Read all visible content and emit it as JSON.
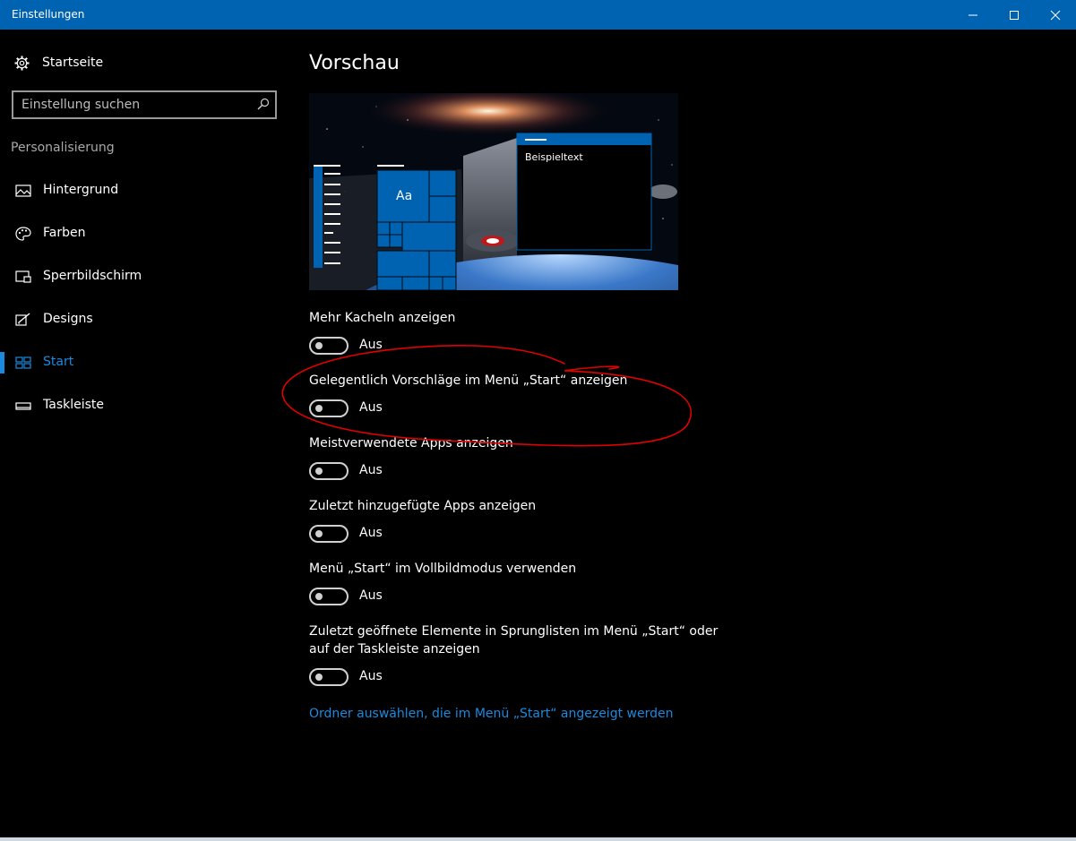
{
  "window": {
    "title": "Einstellungen",
    "controls": {
      "minimize": "—",
      "maximize": "☐",
      "close": "✕"
    },
    "accent": "#0063b1"
  },
  "sidebar": {
    "home_label": "Startseite",
    "search_placeholder": "Einstellung suchen",
    "section_label": "Personalisierung",
    "items": [
      {
        "label": "Hintergrund",
        "icon": "image-icon"
      },
      {
        "label": "Farben",
        "icon": "palette-icon"
      },
      {
        "label": "Sperrbildschirm",
        "icon": "lock-screen-icon"
      },
      {
        "label": "Designs",
        "icon": "brush-icon"
      },
      {
        "label": "Start",
        "icon": "start-tiles-icon",
        "active": true
      },
      {
        "label": "Taskleiste",
        "icon": "taskbar-icon"
      }
    ]
  },
  "main": {
    "title": "Vorschau",
    "preview": {
      "tile_label": "Aa",
      "window_text": "Beispieltext"
    },
    "options": [
      {
        "label": "Mehr Kacheln anzeigen",
        "state": "Aus"
      },
      {
        "label": "Gelegentlich Vorschläge im Menü „Start“ anzeigen",
        "state": "Aus"
      },
      {
        "label": "Meistverwendete Apps anzeigen",
        "state": "Aus"
      },
      {
        "label": "Zuletzt hinzugefügte Apps anzeigen",
        "state": "Aus"
      },
      {
        "label": "Menü „Start“ im Vollbildmodus verwenden",
        "state": "Aus"
      },
      {
        "label_line1": "Zuletzt geöffnete Elemente in Sprunglisten im Menü „Start“ oder",
        "label_line2": "auf der Taskleiste anzeigen",
        "state": "Aus"
      }
    ],
    "link": "Ordner auswählen, die im Menü „Start“ angezeigt werden",
    "link_color": "#1a8ae0"
  },
  "annotation_color": "#e00000"
}
